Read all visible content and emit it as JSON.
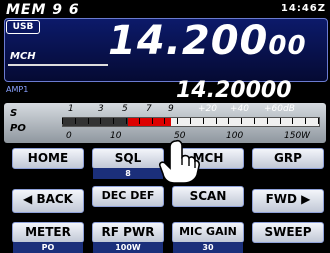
{
  "header": {
    "memory": "MEM 9 6",
    "time": "14:46Z",
    "mode": "USB",
    "channel_label": "MCH"
  },
  "frequency": {
    "main_int": "14.200",
    "main_small": "00",
    "sub": "14.20000",
    "amp_label": "AMP1"
  },
  "meter": {
    "s_label": "S",
    "po_label": "PO",
    "s_scale": [
      "1",
      "3",
      "5",
      "7",
      "9",
      "+20",
      "+40",
      "+60dB"
    ],
    "po_scale": [
      "0",
      "10",
      "50",
      "100",
      "150W"
    ],
    "level_fraction": 0.42
  },
  "buttons": {
    "row1": [
      "HOME",
      "SQL",
      "MCH",
      "GRP"
    ],
    "sql_value": "8",
    "row2": [
      "BACK",
      "DEC DEF",
      "SCAN",
      "FWD"
    ],
    "row3": [
      "METER",
      "RF PWR",
      "MIC GAIN",
      "SWEEP"
    ],
    "row3_values": [
      "PO",
      "100W",
      "30",
      ""
    ]
  },
  "colors": {
    "accent": "#1b2f7a",
    "meter_red": "#dd0000",
    "panel_top": "#0c1a6a"
  }
}
